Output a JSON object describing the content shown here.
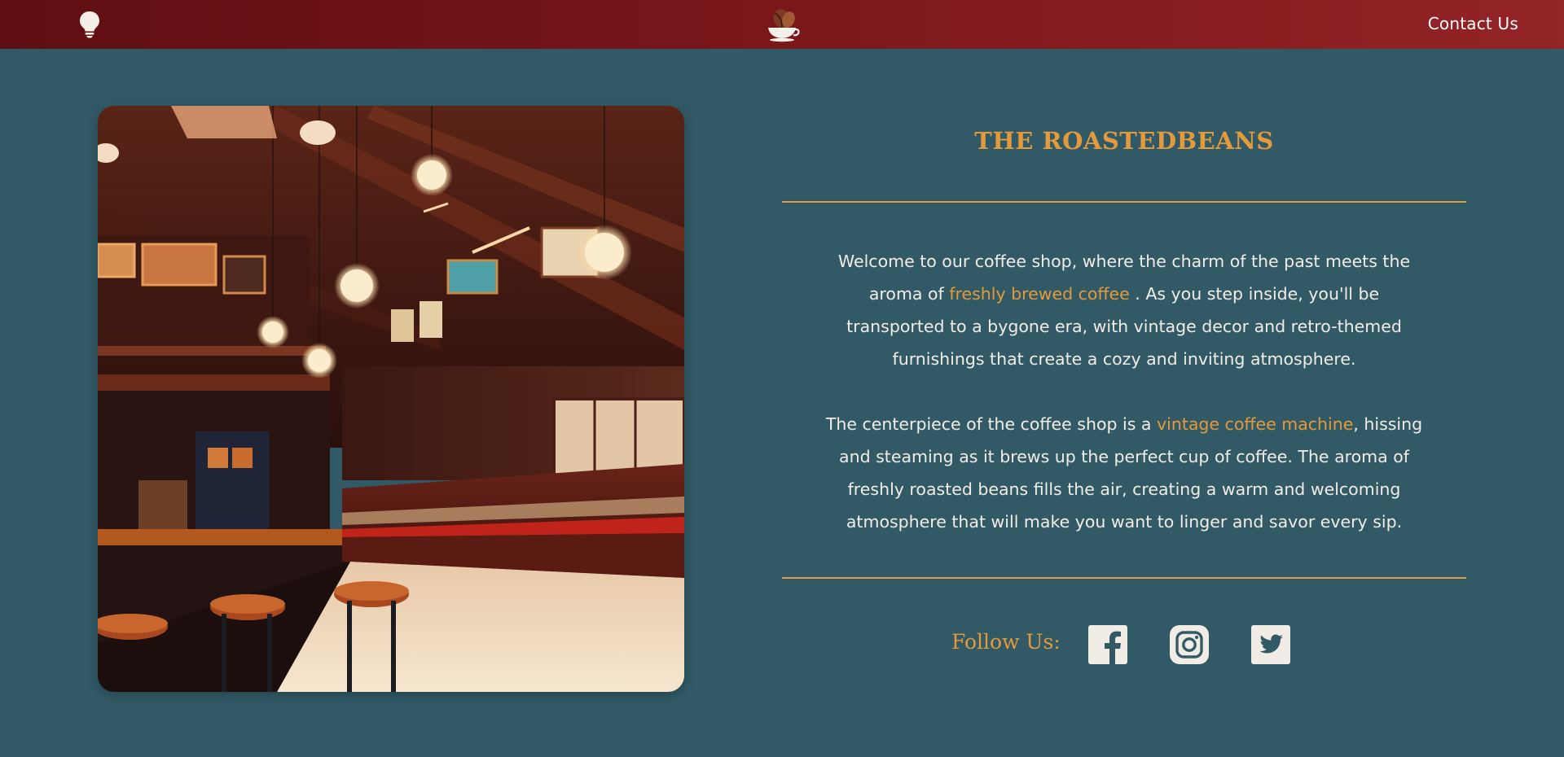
{
  "header": {
    "contact_label": "Contact Us",
    "icons": [
      "lightbulb-icon",
      "coffee-cup-logo"
    ]
  },
  "hero_image": {
    "subject": "vintage coffee shop interior"
  },
  "about": {
    "title": "THE ROASTEDBEANS",
    "paragraph1": {
      "before": "Welcome to our coffee shop, where the charm of the past meets the aroma of ",
      "highlight": "freshly brewed coffee",
      "after": " . As you step inside, you'll be transported to a bygone era, with vintage decor and retro-themed furnishings that create a cozy and inviting atmosphere."
    },
    "paragraph2": {
      "before": "The centerpiece of the coffee shop is a ",
      "highlight": "vintage coffee machine",
      "after": ", hissing and steaming as it brews up the perfect cup of coffee. The aroma of freshly roasted beans fills the air, creating a warm and welcoming atmosphere that will make you want to linger and savor every sip."
    }
  },
  "social": {
    "label": "Follow Us:",
    "links": [
      {
        "name": "facebook-icon"
      },
      {
        "name": "instagram-icon"
      },
      {
        "name": "twitter-icon"
      }
    ]
  },
  "colors": {
    "background": "#325a66",
    "header_start": "#5e0e12",
    "header_end": "#932427",
    "accent": "#e29a3c",
    "text": "#f1ede6"
  }
}
